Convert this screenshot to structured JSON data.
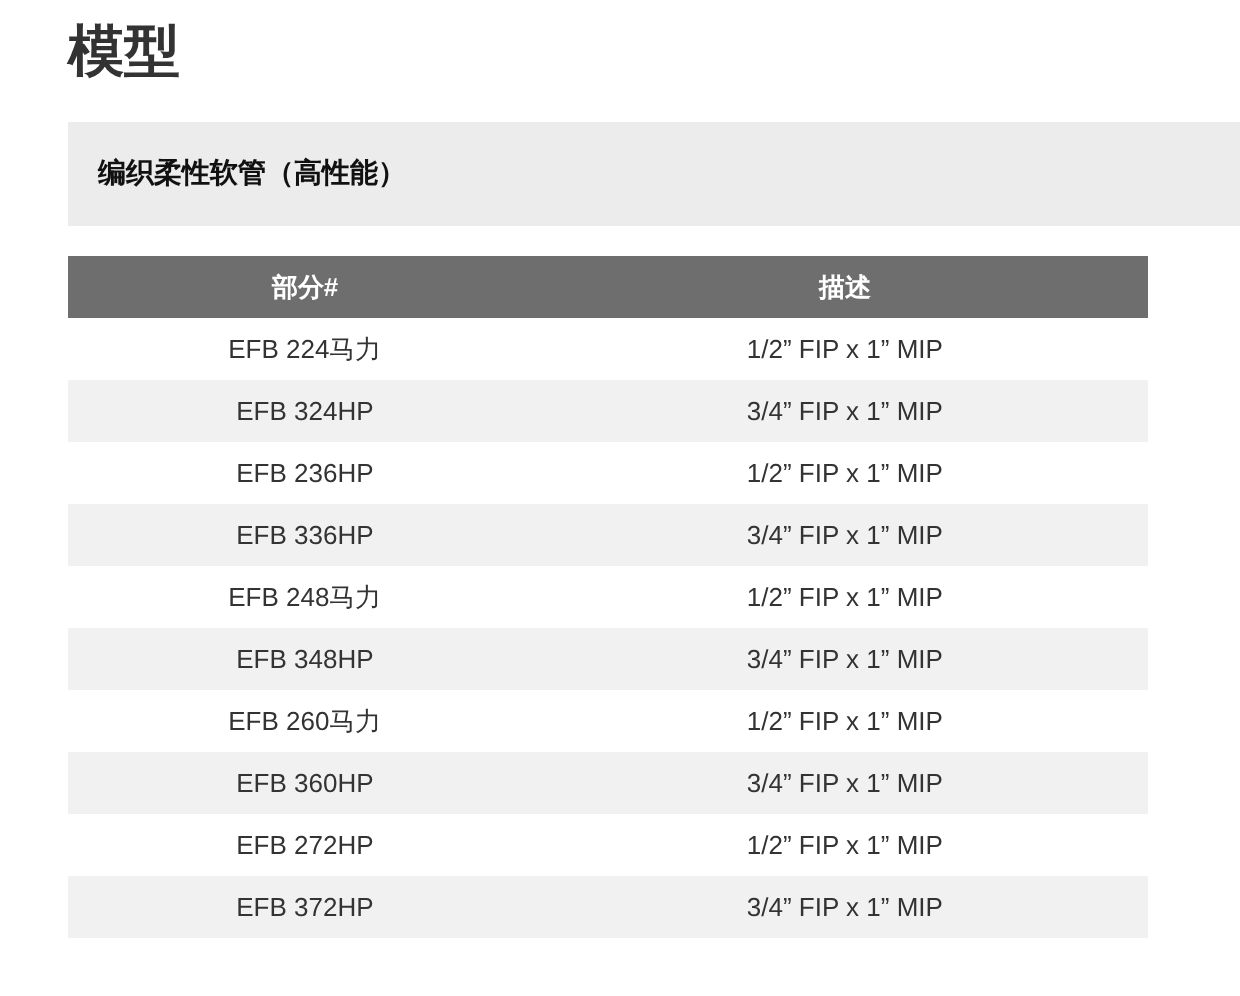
{
  "title": "模型",
  "section": {
    "heading": "编织柔性软管（高性能）"
  },
  "table": {
    "columns": [
      "部分#",
      "描述"
    ],
    "rows": [
      [
        "EFB 224马力",
        "1/2” FIP x 1” MIP"
      ],
      [
        "EFB 324HP",
        "3/4” FIP x 1” MIP"
      ],
      [
        "EFB 236HP",
        "1/2” FIP x 1” MIP"
      ],
      [
        "EFB 336HP",
        "3/4” FIP x 1” MIP"
      ],
      [
        "EFB 248马力",
        "1/2” FIP x 1” MIP"
      ],
      [
        "EFB 348HP",
        "3/4” FIP x 1” MIP"
      ],
      [
        "EFB 260马力",
        "1/2” FIP x 1” MIP"
      ],
      [
        "EFB 360HP",
        "3/4” FIP x 1” MIP"
      ],
      [
        "EFB 272HP",
        "1/2” FIP x 1” MIP"
      ],
      [
        "EFB 372HP",
        "3/4” FIP x 1” MIP"
      ]
    ]
  }
}
